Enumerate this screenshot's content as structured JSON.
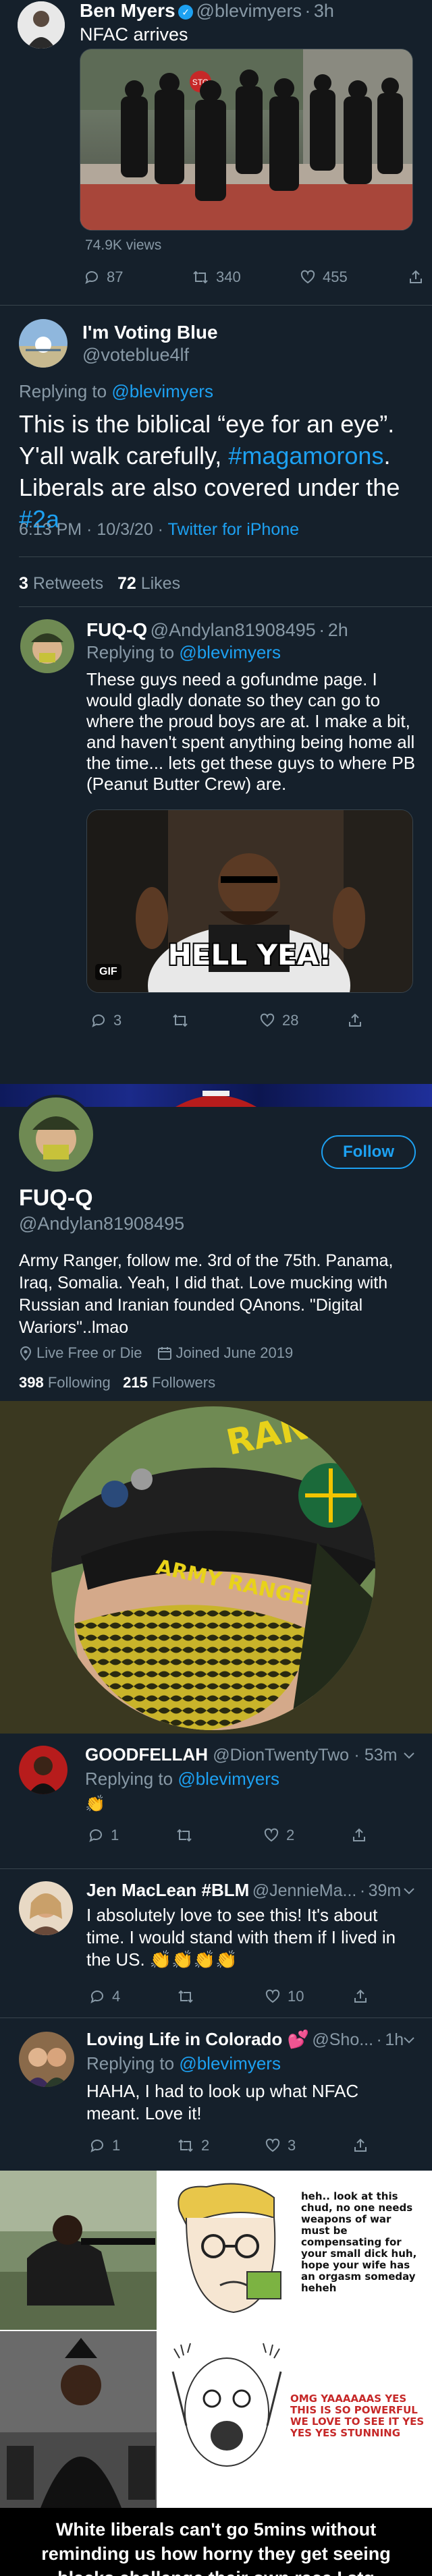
{
  "tweet1": {
    "name": "Ben Myers",
    "handle": "@blevimyers",
    "time": "3h",
    "text": "NFAC arrives",
    "views": "74.9K views",
    "replies": "87",
    "retweets": "340",
    "likes": "455"
  },
  "tweet2": {
    "name": "I'm Voting Blue",
    "handle": "@voteblue4lf",
    "replying_prefix": "Replying to",
    "replying_to": "@blevimyers",
    "text_part1": "This is the biblical “eye for an eye”. Y'all walk carefully,",
    "hashtag1": "#magamorons",
    "text_part2": ". Liberals are also covered under the",
    "hashtag2": "#2a",
    "timestamp": "6:13 PM · 10/3/20 ·",
    "source": "Twitter for iPhone",
    "retweets_count": "3",
    "retweets_label": "Retweets",
    "likes_count": "72",
    "likes_label": "Likes"
  },
  "tweet3": {
    "name": "FUQ-Q",
    "handle": "@Andylan81908495",
    "time": "2h",
    "replying_prefix": "Replying to",
    "replying_to": "@blevimyers",
    "text": "These guys need a gofundme page. I would gladly donate so they can go to where the proud boys are at. I make a bit, and haven't spent anything being home all the time... lets get these guys to where PB (Peanut Butter Crew) are.",
    "gif_caption": "HELL YEA!",
    "gif_badge": "GIF",
    "replies": "3",
    "likes": "28"
  },
  "profile": {
    "follow_label": "Follow",
    "name": "FUQ-Q",
    "handle": "@Andylan81908495",
    "bio": "Army Ranger, follow me. 3rd of the 75th. Panama, Iraq, Somalia. Yeah, I did that. Love mucking with Russian and Iranian founded QAnons. \"Digital Wariors\"..lmao",
    "location": "Live Free or Die",
    "joined": "Joined June 2019",
    "following_count": "398",
    "following_label": "Following",
    "followers_count": "215",
    "followers_label": "Followers",
    "hat_text": "RANGER",
    "brim_text": "ARMY RANGER"
  },
  "reply1": {
    "name": "GOODFELLAH",
    "handle": "@DionTwentyTwo",
    "time": "53m",
    "replying_prefix": "Replying to",
    "replying_to": "@blevimyers",
    "emoji": "👏",
    "replies": "1",
    "likes": "2"
  },
  "reply2": {
    "name": "Jen MacLean #BLM",
    "handle": "@JennieMa...",
    "time": "39m",
    "text": "I absolutely love to see this! It's about time. I would stand with them if I lived in the US. 👏👏👏👏",
    "replies": "4",
    "likes": "10"
  },
  "reply3": {
    "name": "Loving Life in Colorado 💕",
    "handle": "@Sho...",
    "time": "1h",
    "replying_prefix": "Replying to",
    "replying_to": "@blevimyers",
    "text": "HAHA, I had to look up what NFAC meant. Love it!",
    "replies": "1",
    "retweets": "2",
    "likes": "3"
  },
  "meme": {
    "text_top": "heh.. look at this chud, no one needs weapons of war must be compensating for your small dick huh, hope your wife has an orgasm someday heheh",
    "text_bottom": "OMG YAAAAAAS YES THIS IS SO POWERFUL WE LOVE TO SEE IT YES YES YES STUNNING",
    "caption": "White liberals can't go 5mins without reminding us how horny they get seeing blacks challenge their own race I stg"
  }
}
